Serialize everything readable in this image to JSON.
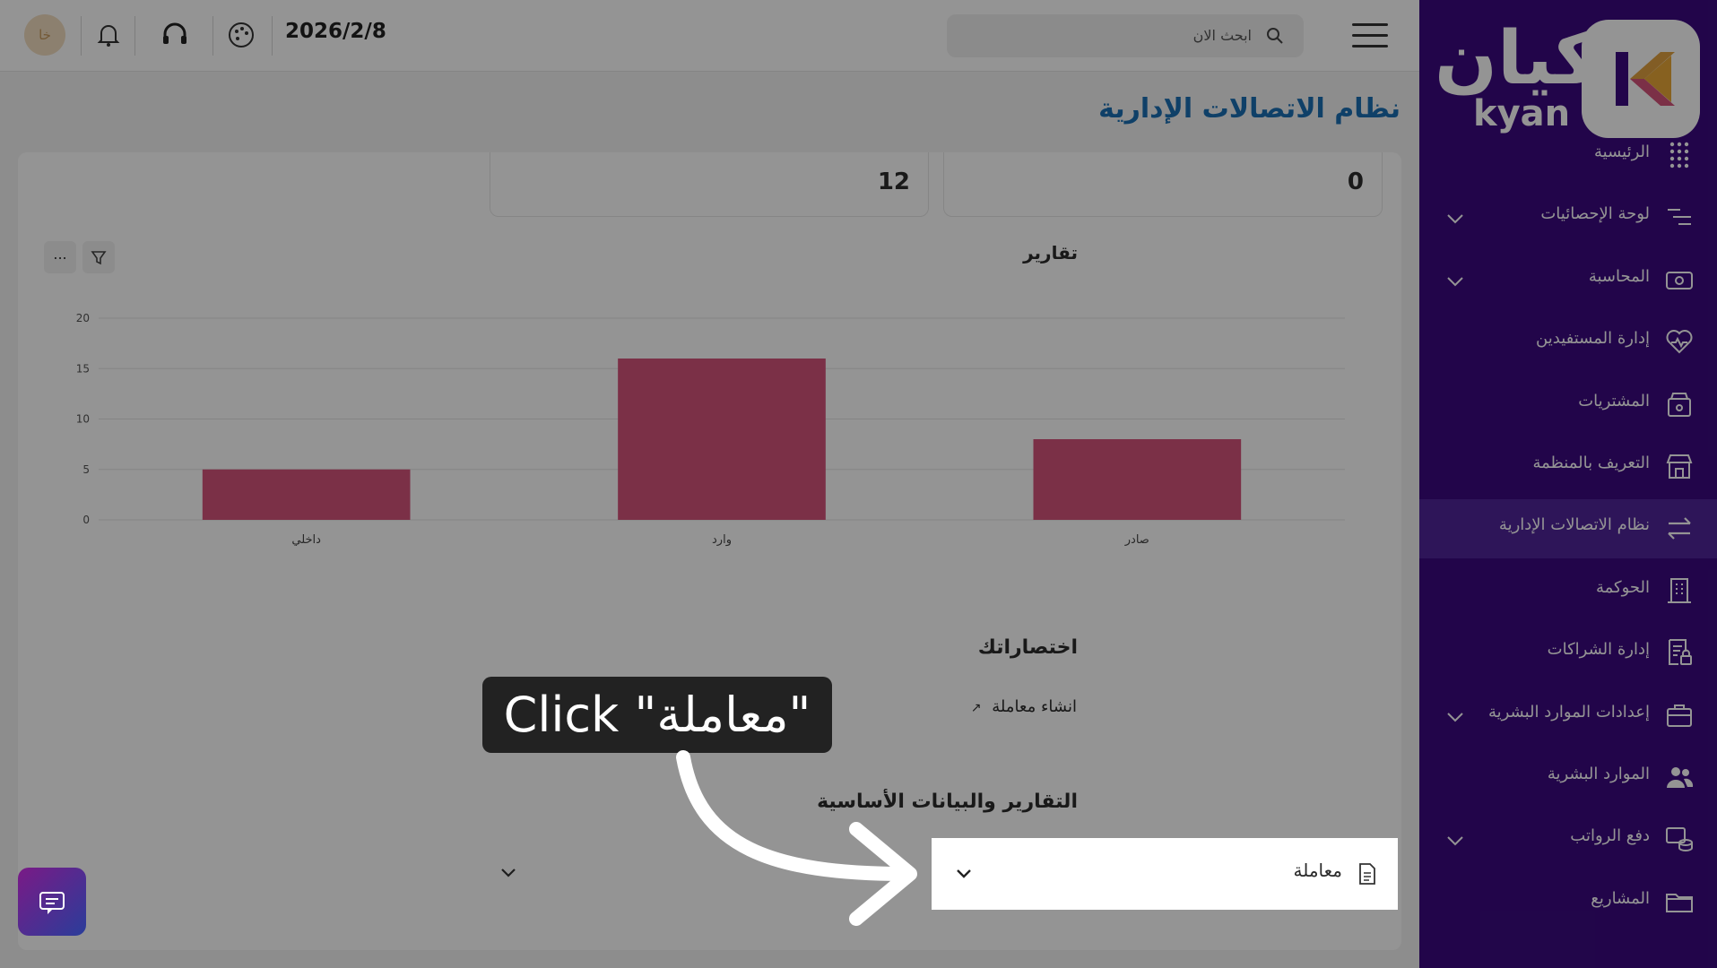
{
  "topbar": {
    "search_placeholder": "ابحث الان",
    "date": "2026/2/8",
    "avatar_initials": "خا"
  },
  "page": {
    "title": "نظام الاتصالات الإدارية"
  },
  "stats": [
    {
      "value": "0"
    },
    {
      "value": "12"
    }
  ],
  "reports": {
    "title": "تقارير",
    "more_label": "..."
  },
  "chart_data": {
    "type": "bar",
    "categories": [
      "صادر",
      "وارد",
      "داخلي"
    ],
    "values": [
      8,
      16,
      5
    ],
    "ylim": [
      0,
      20
    ],
    "yticks": [
      0,
      5,
      10,
      15,
      20
    ],
    "color": "#d4537a",
    "grid": true
  },
  "shortcuts": {
    "title": "اختصاراتك",
    "items": [
      {
        "label": "انشاء معاملة"
      }
    ]
  },
  "basic_data": {
    "title": "التقارير والبيانات الأساسية",
    "dropdown_label": "معاملة"
  },
  "overlay": {
    "instruction": "Click \"معاملة\""
  },
  "sidebar": {
    "logo_ar": "كيان",
    "logo_en": "kyan",
    "items": [
      {
        "label": "الرئيسية",
        "icon": "grid-dots-icon",
        "chevron": false,
        "active": false
      },
      {
        "label": "لوحة الإحصائيات",
        "icon": "sliders-icon",
        "chevron": true,
        "active": false
      },
      {
        "label": "المحاسبة",
        "icon": "money-icon",
        "chevron": true,
        "active": false
      },
      {
        "label": "إدارة المستفيدين",
        "icon": "heart-pulse-icon",
        "chevron": false,
        "active": false
      },
      {
        "label": "المشتريات",
        "icon": "box-icon",
        "chevron": false,
        "active": false
      },
      {
        "label": "التعريف بالمنظمة",
        "icon": "store-icon",
        "chevron": false,
        "active": false
      },
      {
        "label": "نظام الاتصالات الإدارية",
        "icon": "arrows-exchange-icon",
        "chevron": false,
        "active": true
      },
      {
        "label": "الحوكمة",
        "icon": "building-icon",
        "chevron": false,
        "active": false
      },
      {
        "label": "إدارة الشراكات",
        "icon": "document-lock-icon",
        "chevron": false,
        "active": false
      },
      {
        "label": "إعدادات الموارد البشرية",
        "icon": "briefcase-icon",
        "chevron": true,
        "active": false
      },
      {
        "label": "الموارد البشرية",
        "icon": "users-icon",
        "chevron": false,
        "active": false
      },
      {
        "label": "دفع الرواتب",
        "icon": "coins-icon",
        "chevron": true,
        "active": false
      },
      {
        "label": "المشاريع",
        "icon": "folder-icon",
        "chevron": false,
        "active": false
      }
    ]
  }
}
